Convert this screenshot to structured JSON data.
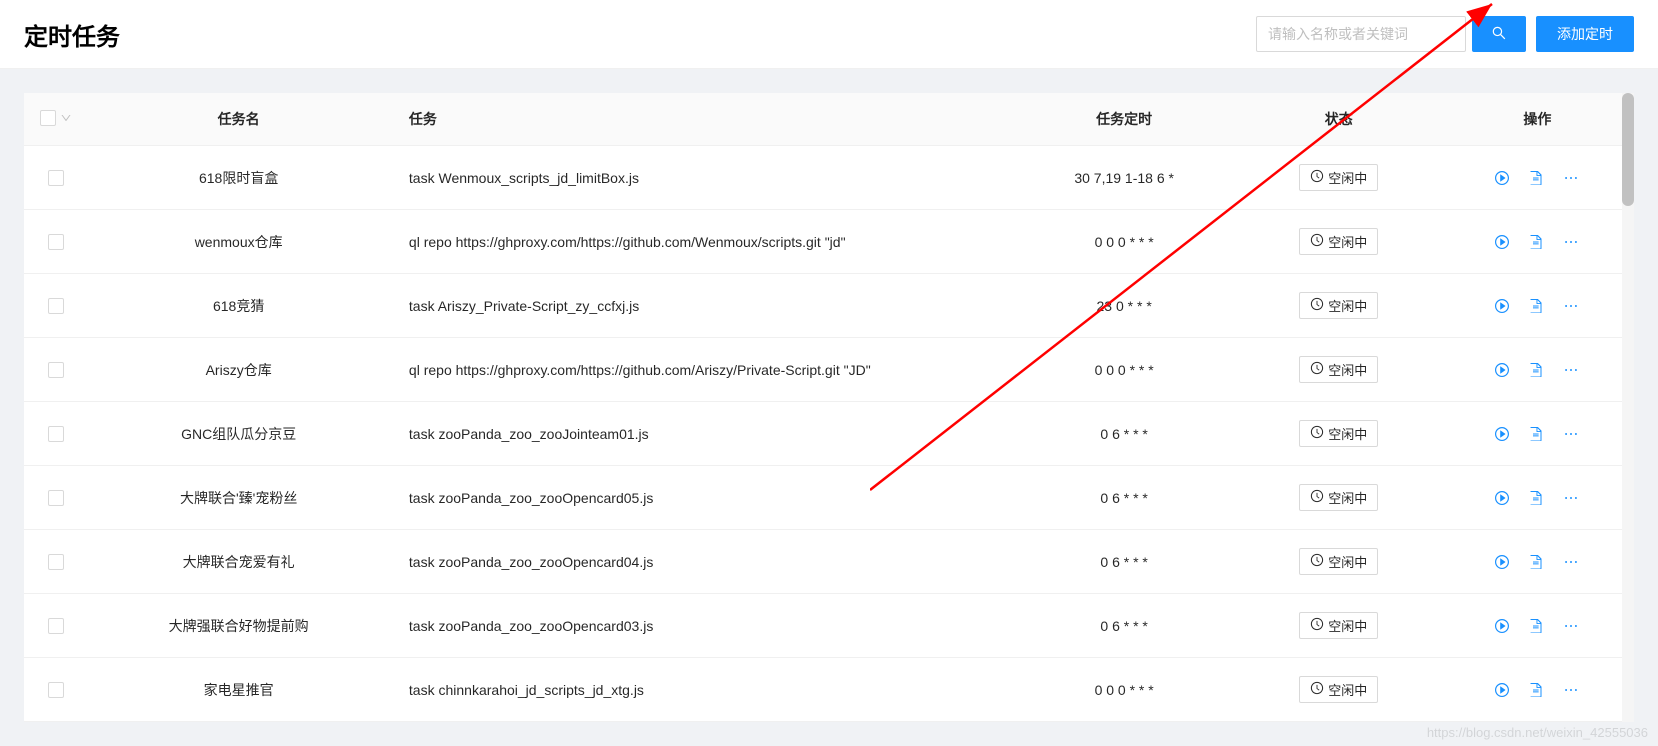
{
  "header": {
    "title": "定时任务",
    "search_placeholder": "请输入名称或者关键词",
    "add_button_label": "添加定时"
  },
  "table": {
    "columns": {
      "name": "任务名",
      "task": "任务",
      "cron": "任务定时",
      "status": "状态",
      "ops": "操作"
    },
    "status_idle": "空闲中",
    "rows": [
      {
        "name": "618限时盲盒",
        "task": "task Wenmoux_scripts_jd_limitBox.js",
        "cron": "30 7,19 1-18 6 *"
      },
      {
        "name": "wenmoux仓库",
        "task": "ql repo https://ghproxy.com/https://github.com/Wenmoux/scripts.git \"jd\"",
        "cron": "0 0 0 * * *"
      },
      {
        "name": "618竞猜",
        "task": "task Ariszy_Private-Script_zy_ccfxj.js",
        "cron": "23 0 * * *"
      },
      {
        "name": "Ariszy仓库",
        "task": "ql repo https://ghproxy.com/https://github.com/Ariszy/Private-Script.git \"JD\"",
        "cron": "0 0 0 * * *"
      },
      {
        "name": "GNC组队瓜分京豆",
        "task": "task zooPanda_zoo_zooJointeam01.js",
        "cron": "0 6 * * *"
      },
      {
        "name": "大牌联合'臻'宠粉丝",
        "task": "task zooPanda_zoo_zooOpencard05.js",
        "cron": "0 6 * * *"
      },
      {
        "name": "大牌联合宠爱有礼",
        "task": "task zooPanda_zoo_zooOpencard04.js",
        "cron": "0 6 * * *"
      },
      {
        "name": "大牌强联合好物提前购",
        "task": "task zooPanda_zoo_zooOpencard03.js",
        "cron": "0 6 * * *"
      },
      {
        "name": "家电星推官",
        "task": "task chinnkarahoi_jd_scripts_jd_xtg.js",
        "cron": "0 0 0 * * *"
      }
    ]
  },
  "watermark": "https://blog.csdn.net/weixin_42555036"
}
